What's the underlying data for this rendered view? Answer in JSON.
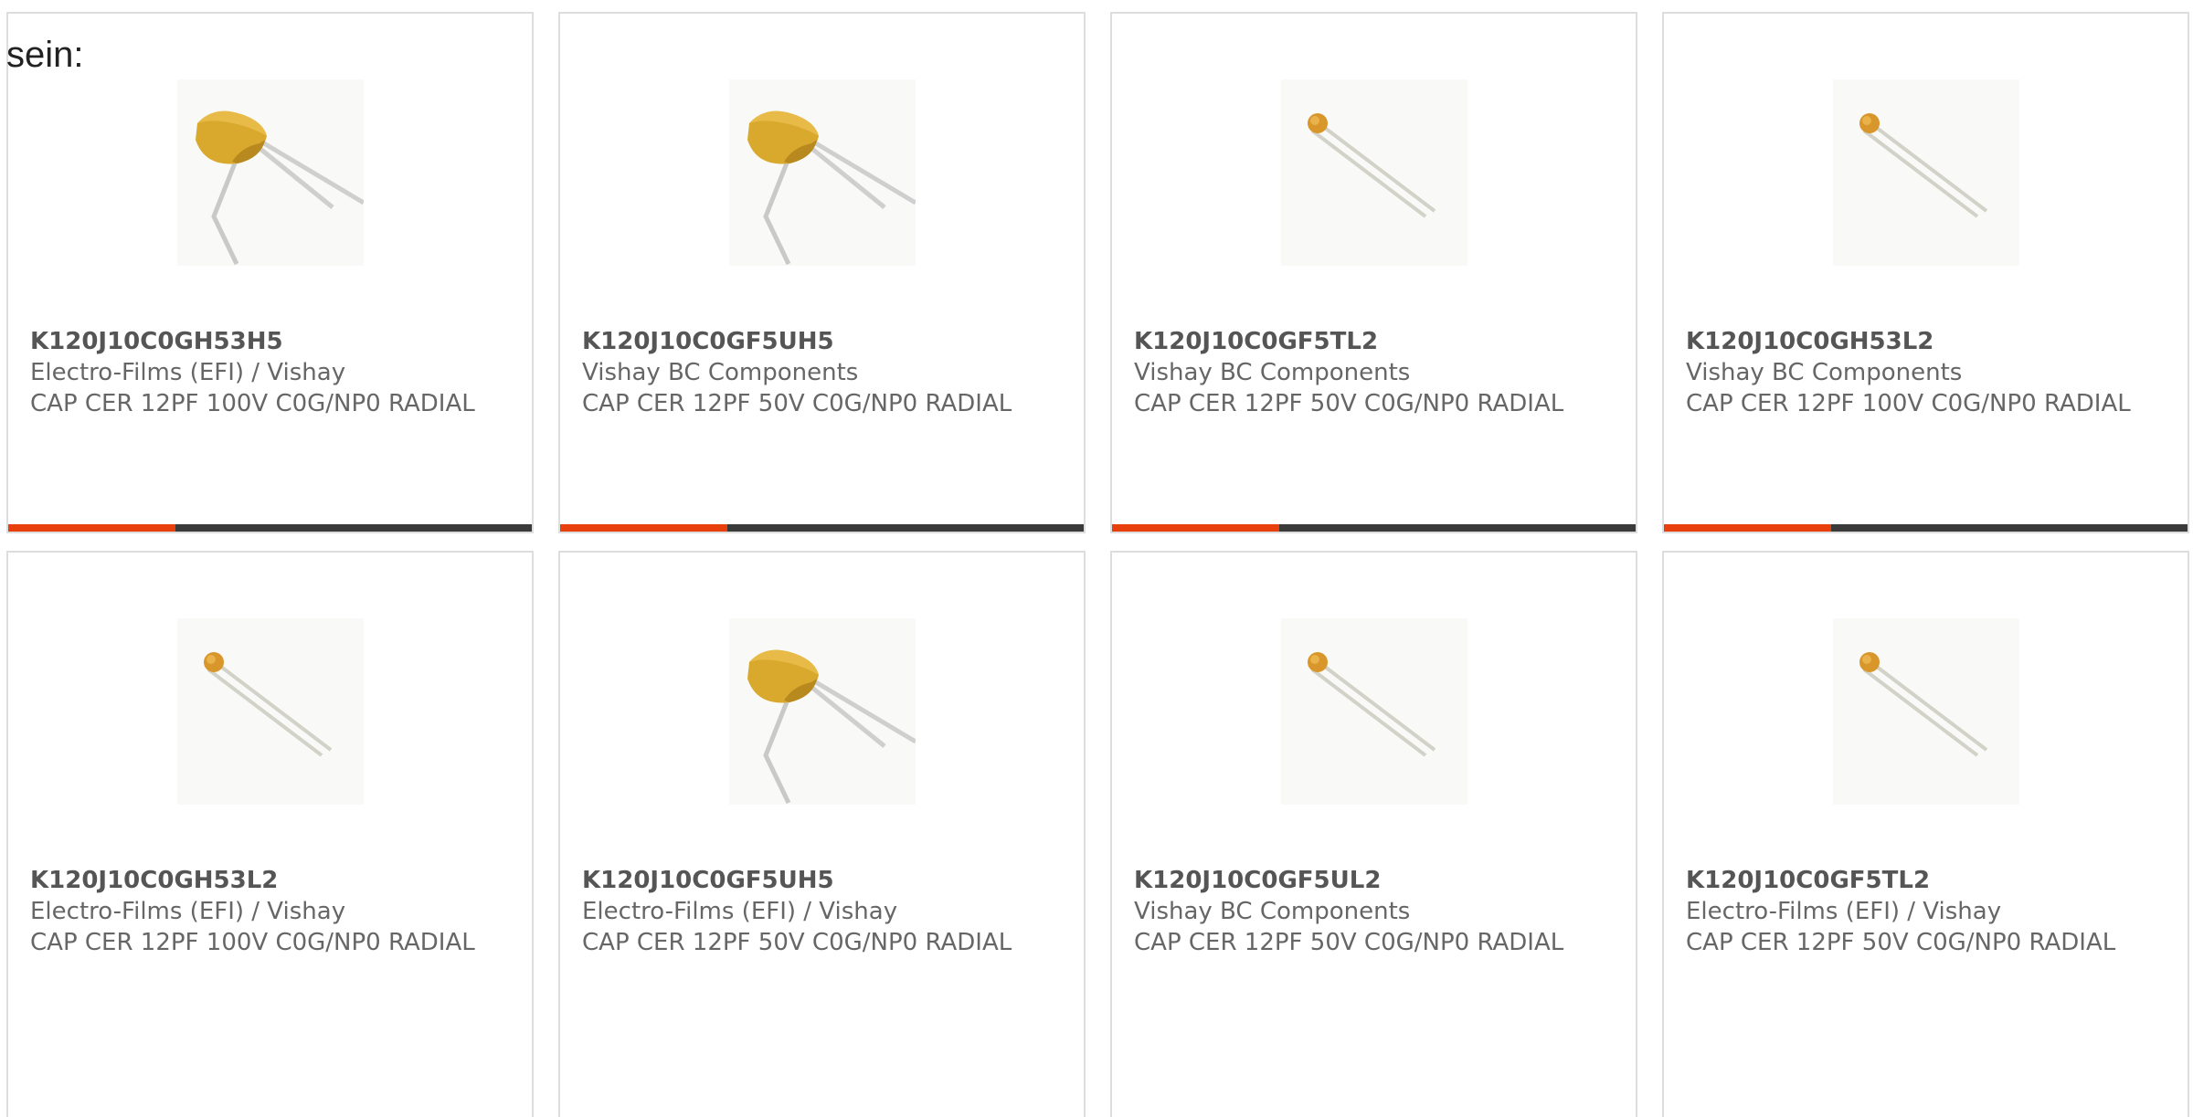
{
  "intro_text": "sein:",
  "colors": {
    "accent": "#e8400c",
    "track": "#3a3a3a",
    "capacitor_body": "#d9a92e",
    "card_border": "#dddddd",
    "text": "#666666"
  },
  "products": [
    {
      "part_number": "K120J10C0GH53H5",
      "manufacturer": "Electro-Films (EFI) / Vishay",
      "description": "CAP CER 12PF 100V C0G/NP0 RADIAL",
      "image_icon": "large-radial-capacitor-icon",
      "progress": 0.32
    },
    {
      "part_number": "K120J10C0GF5UH5",
      "manufacturer": "Vishay BC Components",
      "description": "CAP CER 12PF 50V C0G/NP0 RADIAL",
      "image_icon": "large-radial-capacitor-icon",
      "progress": 0.32
    },
    {
      "part_number": "K120J10C0GF5TL2",
      "manufacturer": "Vishay BC Components",
      "description": "CAP CER 12PF 50V C0G/NP0 RADIAL",
      "image_icon": "small-radial-capacitor-icon",
      "progress": 0.32
    },
    {
      "part_number": "K120J10C0GH53L2",
      "manufacturer": "Vishay BC Components",
      "description": "CAP CER 12PF 100V C0G/NP0 RADIAL",
      "image_icon": "small-radial-capacitor-icon",
      "progress": 0.32
    },
    {
      "part_number": "K120J10C0GH53L2",
      "manufacturer": "Electro-Films (EFI) / Vishay",
      "description": "CAP CER 12PF 100V C0G/NP0 RADIAL",
      "image_icon": "small-radial-capacitor-icon"
    },
    {
      "part_number": "K120J10C0GF5UH5",
      "manufacturer": "Electro-Films (EFI) / Vishay",
      "description": "CAP CER 12PF 50V C0G/NP0 RADIAL",
      "image_icon": "large-radial-capacitor-icon"
    },
    {
      "part_number": "K120J10C0GF5UL2",
      "manufacturer": "Vishay BC Components",
      "description": "CAP CER 12PF 50V C0G/NP0 RADIAL",
      "image_icon": "small-radial-capacitor-icon"
    },
    {
      "part_number": "K120J10C0GF5TL2",
      "manufacturer": "Electro-Films (EFI) / Vishay",
      "description": "CAP CER 12PF 50V C0G/NP0 RADIAL",
      "image_icon": "small-radial-capacitor-icon"
    }
  ]
}
